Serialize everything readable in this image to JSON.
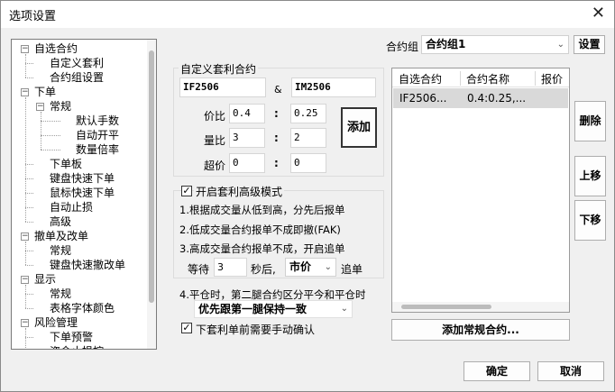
{
  "window": {
    "title": "选项设置",
    "close_glyph": "✕"
  },
  "tree": {
    "items": [
      {
        "label": "自选合约",
        "toggle": "−"
      },
      {
        "label": "自定义套利"
      },
      {
        "label": "合约组设置"
      },
      {
        "label": "下单",
        "toggle": "−"
      },
      {
        "label": "常规",
        "toggle": "−"
      },
      {
        "label": "默认手数"
      },
      {
        "label": "自动开平"
      },
      {
        "label": "数量倍率"
      },
      {
        "label": "下单板"
      },
      {
        "label": "键盘快速下单"
      },
      {
        "label": "鼠标快速下单"
      },
      {
        "label": "自动止损"
      },
      {
        "label": "高级"
      },
      {
        "label": "撤单及改单",
        "toggle": "−"
      },
      {
        "label": "常规"
      },
      {
        "label": "键盘快速撤改单"
      },
      {
        "label": "显示",
        "toggle": "−"
      },
      {
        "label": "常规"
      },
      {
        "label": "表格字体颜色"
      },
      {
        "label": "风险管理",
        "toggle": "−"
      },
      {
        "label": "下单预警"
      },
      {
        "label": "资金止损控"
      }
    ]
  },
  "contract_group": {
    "label": "合约组",
    "value": "合约组1",
    "settings_button": "设置"
  },
  "custom_arb": {
    "legend": "自定义套利合约",
    "leg1": "IF2506",
    "amp": "&",
    "leg2": "IM2506",
    "price_ratio_label": "价比",
    "price_ratio_1": "0.4",
    "price_ratio_2": "0.25",
    "qty_ratio_label": "量比",
    "qty_ratio_1": "3",
    "qty_ratio_2": "2",
    "over_price_label": "超价",
    "over_price_1": "0",
    "over_price_2": "0",
    "colon": ":",
    "add_button": "添加"
  },
  "advanced": {
    "enable_label": "开启套利高级模式",
    "enabled": "✓",
    "rule1": "1.根据成交量从低到高，分先后报单",
    "rule2": "2.低成交量合约报单不成即撤(FAK)",
    "rule3": "3.高成交量合约报单不成，开启追单",
    "wait_label": "等待",
    "wait_value": "3",
    "after_label": "秒后,",
    "order_type": "市价",
    "chase_label": "追单",
    "rule4": "4.平仓时，第二腿合约区分平今和平仓时",
    "rule4_option": "优先跟第一腿保持一致",
    "confirm_label": "下套利单前需要手动确认",
    "confirm_checked": "✓"
  },
  "list": {
    "columns": [
      "自选合约",
      "合约名称",
      "报价"
    ],
    "rows": [
      {
        "contract": "IF2506...",
        "name": "0.4:0.25,..."
      }
    ]
  },
  "side_buttons": {
    "delete": "删除",
    "up": "上移",
    "down": "下移"
  },
  "add_regular_button": "添加常规合约...",
  "footer": {
    "ok": "确定",
    "cancel": "取消"
  }
}
